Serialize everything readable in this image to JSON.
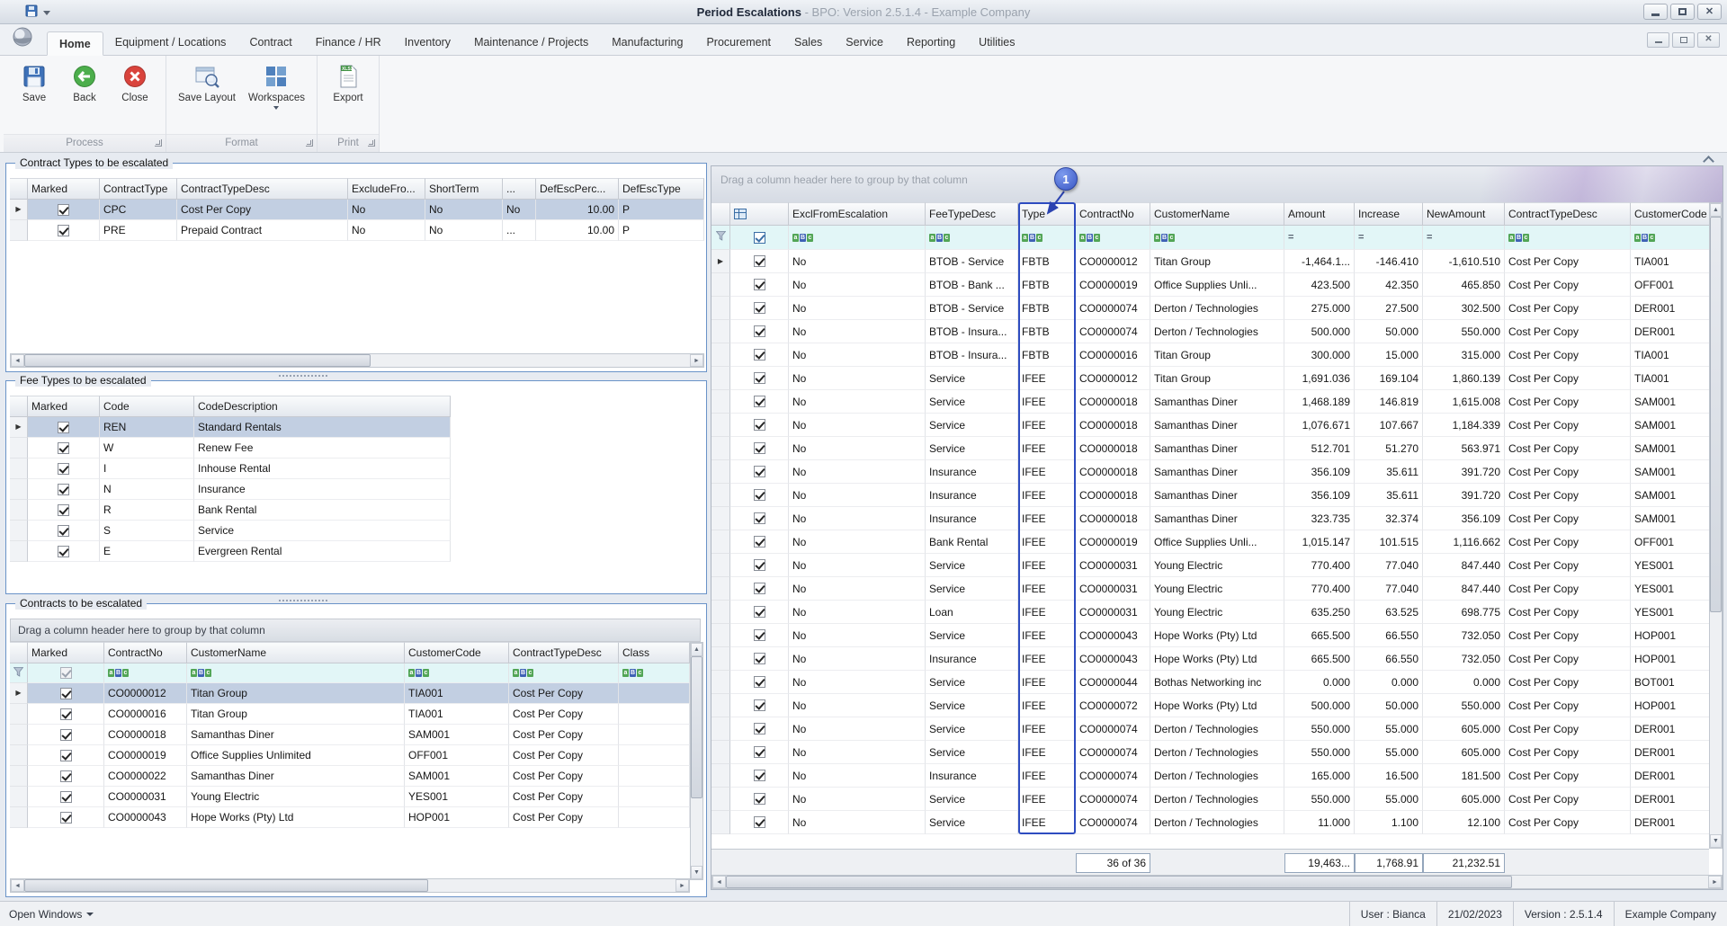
{
  "titlebar": {
    "title_main": "Period Escalations",
    "title_sub": " - BPO: Version 2.5.1.4 - Example Company"
  },
  "tabs": [
    "Home",
    "Equipment / Locations",
    "Contract",
    "Finance / HR",
    "Inventory",
    "Maintenance / Projects",
    "Manufacturing",
    "Procurement",
    "Sales",
    "Service",
    "Reporting",
    "Utilities"
  ],
  "active_tab": "Home",
  "ribbon_groups": [
    {
      "label": "Process",
      "buttons": [
        {
          "label": "Save",
          "icon": "save"
        },
        {
          "label": "Back",
          "icon": "back"
        },
        {
          "label": "Close",
          "icon": "close"
        }
      ]
    },
    {
      "label": "Format",
      "buttons": [
        {
          "label": "Save Layout",
          "icon": "save-layout"
        },
        {
          "label": "Workspaces",
          "icon": "workspaces",
          "dropdown": true
        }
      ]
    },
    {
      "label": "Print",
      "buttons": [
        {
          "label": "Export",
          "icon": "export"
        }
      ]
    }
  ],
  "contract_types": {
    "title": "Contract Types to be escalated",
    "columns": [
      "Marked",
      "ContractType",
      "ContractTypeDesc",
      "ExcludeFro...",
      "ShortTerm",
      "...",
      "DefEscPerc...",
      "DefEscType"
    ],
    "rows": [
      [
        "CPC",
        "Cost Per Copy",
        "No",
        "No",
        "No",
        "10.00",
        "P"
      ],
      [
        "PRE",
        "Prepaid Contract",
        "No",
        "No",
        "...",
        "10.00",
        "P"
      ]
    ]
  },
  "fee_types": {
    "title": "Fee Types to be escalated",
    "columns": [
      "Marked",
      "Code",
      "CodeDescription"
    ],
    "rows": [
      [
        "REN",
        "Standard Rentals"
      ],
      [
        "W",
        "Renew Fee"
      ],
      [
        "I",
        "Inhouse Rental"
      ],
      [
        "N",
        "Insurance"
      ],
      [
        "R",
        "Bank Rental"
      ],
      [
        "S",
        "Service"
      ],
      [
        "E",
        "Evergreen Rental"
      ]
    ]
  },
  "contracts": {
    "title": "Contracts to be escalated",
    "group_hint": "Drag a column header here to group by that column",
    "columns": [
      "Marked",
      "ContractNo",
      "CustomerName",
      "CustomerCode",
      "ContractTypeDesc",
      "Class"
    ],
    "rows": [
      [
        "CO0000012",
        "Titan Group",
        "TIA001",
        "Cost Per Copy",
        ""
      ],
      [
        "CO0000016",
        "Titan Group",
        "TIA001",
        "Cost Per Copy",
        ""
      ],
      [
        "CO0000018",
        "Samanthas Diner",
        "SAM001",
        "Cost Per Copy",
        ""
      ],
      [
        "CO0000019",
        "Office Supplies Unlimited",
        "OFF001",
        "Cost Per Copy",
        ""
      ],
      [
        "CO0000022",
        "Samanthas Diner",
        "SAM001",
        "Cost Per Copy",
        ""
      ],
      [
        "CO0000031",
        "Young Electric",
        "YES001",
        "Cost Per Copy",
        ""
      ],
      [
        "CO0000043",
        "Hope Works (Pty) Ltd",
        "HOP001",
        "Cost Per Copy",
        ""
      ]
    ]
  },
  "main_grid": {
    "group_hint": "Drag a column header here to group by that column",
    "columns": [
      "ExclFromEscalation",
      "FeeTypeDesc",
      "Type",
      "ContractNo",
      "CustomerName",
      "Amount",
      "Increase",
      "NewAmount",
      "ContractTypeDesc",
      "CustomerCode"
    ],
    "rows": [
      [
        "No",
        "BTOB - Service",
        "FBTB",
        "CO0000012",
        "Titan Group",
        "-1,464.1...",
        "-146.410",
        "-1,610.510",
        "Cost Per Copy",
        "TIA001"
      ],
      [
        "No",
        "BTOB - Bank ...",
        "FBTB",
        "CO0000019",
        "Office Supplies Unli...",
        "423.500",
        "42.350",
        "465.850",
        "Cost Per Copy",
        "OFF001"
      ],
      [
        "No",
        "BTOB - Service",
        "FBTB",
        "CO0000074",
        "Derton / Technologies",
        "275.000",
        "27.500",
        "302.500",
        "Cost Per Copy",
        "DER001"
      ],
      [
        "No",
        "BTOB - Insura...",
        "FBTB",
        "CO0000074",
        "Derton / Technologies",
        "500.000",
        "50.000",
        "550.000",
        "Cost Per Copy",
        "DER001"
      ],
      [
        "No",
        "BTOB - Insura...",
        "FBTB",
        "CO0000016",
        "Titan Group",
        "300.000",
        "15.000",
        "315.000",
        "Cost Per Copy",
        "TIA001"
      ],
      [
        "No",
        "Service",
        "IFEE",
        "CO0000012",
        "Titan Group",
        "1,691.036",
        "169.104",
        "1,860.139",
        "Cost Per Copy",
        "TIA001"
      ],
      [
        "No",
        "Service",
        "IFEE",
        "CO0000018",
        "Samanthas Diner",
        "1,468.189",
        "146.819",
        "1,615.008",
        "Cost Per Copy",
        "SAM001"
      ],
      [
        "No",
        "Service",
        "IFEE",
        "CO0000018",
        "Samanthas Diner",
        "1,076.671",
        "107.667",
        "1,184.339",
        "Cost Per Copy",
        "SAM001"
      ],
      [
        "No",
        "Service",
        "IFEE",
        "CO0000018",
        "Samanthas Diner",
        "512.701",
        "51.270",
        "563.971",
        "Cost Per Copy",
        "SAM001"
      ],
      [
        "No",
        "Insurance",
        "IFEE",
        "CO0000018",
        "Samanthas Diner",
        "356.109",
        "35.611",
        "391.720",
        "Cost Per Copy",
        "SAM001"
      ],
      [
        "No",
        "Insurance",
        "IFEE",
        "CO0000018",
        "Samanthas Diner",
        "356.109",
        "35.611",
        "391.720",
        "Cost Per Copy",
        "SAM001"
      ],
      [
        "No",
        "Insurance",
        "IFEE",
        "CO0000018",
        "Samanthas Diner",
        "323.735",
        "32.374",
        "356.109",
        "Cost Per Copy",
        "SAM001"
      ],
      [
        "No",
        "Bank Rental",
        "IFEE",
        "CO0000019",
        "Office Supplies Unli...",
        "1,015.147",
        "101.515",
        "1,116.662",
        "Cost Per Copy",
        "OFF001"
      ],
      [
        "No",
        "Service",
        "IFEE",
        "CO0000031",
        "Young Electric",
        "770.400",
        "77.040",
        "847.440",
        "Cost Per Copy",
        "YES001"
      ],
      [
        "No",
        "Service",
        "IFEE",
        "CO0000031",
        "Young Electric",
        "770.400",
        "77.040",
        "847.440",
        "Cost Per Copy",
        "YES001"
      ],
      [
        "No",
        "Loan",
        "IFEE",
        "CO0000031",
        "Young Electric",
        "635.250",
        "63.525",
        "698.775",
        "Cost Per Copy",
        "YES001"
      ],
      [
        "No",
        "Service",
        "IFEE",
        "CO0000043",
        "Hope Works (Pty) Ltd",
        "665.500",
        "66.550",
        "732.050",
        "Cost Per Copy",
        "HOP001"
      ],
      [
        "No",
        "Insurance",
        "IFEE",
        "CO0000043",
        "Hope Works (Pty) Ltd",
        "665.500",
        "66.550",
        "732.050",
        "Cost Per Copy",
        "HOP001"
      ],
      [
        "No",
        "Service",
        "IFEE",
        "CO0000044",
        "Bothas Networking inc",
        "0.000",
        "0.000",
        "0.000",
        "Cost Per Copy",
        "BOT001"
      ],
      [
        "No",
        "Service",
        "IFEE",
        "CO0000072",
        "Hope Works (Pty) Ltd",
        "500.000",
        "50.000",
        "550.000",
        "Cost Per Copy",
        "HOP001"
      ],
      [
        "No",
        "Service",
        "IFEE",
        "CO0000074",
        "Derton / Technologies",
        "550.000",
        "55.000",
        "605.000",
        "Cost Per Copy",
        "DER001"
      ],
      [
        "No",
        "Service",
        "IFEE",
        "CO0000074",
        "Derton / Technologies",
        "550.000",
        "55.000",
        "605.000",
        "Cost Per Copy",
        "DER001"
      ],
      [
        "No",
        "Insurance",
        "IFEE",
        "CO0000074",
        "Derton / Technologies",
        "165.000",
        "16.500",
        "181.500",
        "Cost Per Copy",
        "DER001"
      ],
      [
        "No",
        "Service",
        "IFEE",
        "CO0000074",
        "Derton / Technologies",
        "550.000",
        "55.000",
        "605.000",
        "Cost Per Copy",
        "DER001"
      ],
      [
        "No",
        "Service",
        "IFEE",
        "CO0000074",
        "Derton / Technologies",
        "11.000",
        "1.100",
        "12.100",
        "Cost Per Copy",
        "DER001"
      ]
    ],
    "footer": {
      "count": "36 of 36",
      "amount": "19,463...",
      "increase": "1,768.91",
      "new_amount": "21,232.51"
    },
    "callout_label": "1"
  },
  "statusbar": {
    "open_windows": "Open Windows",
    "user": "User : Bianca",
    "date": "21/02/2023",
    "version": "Version : 2.5.1.4",
    "company": "Example Company"
  }
}
